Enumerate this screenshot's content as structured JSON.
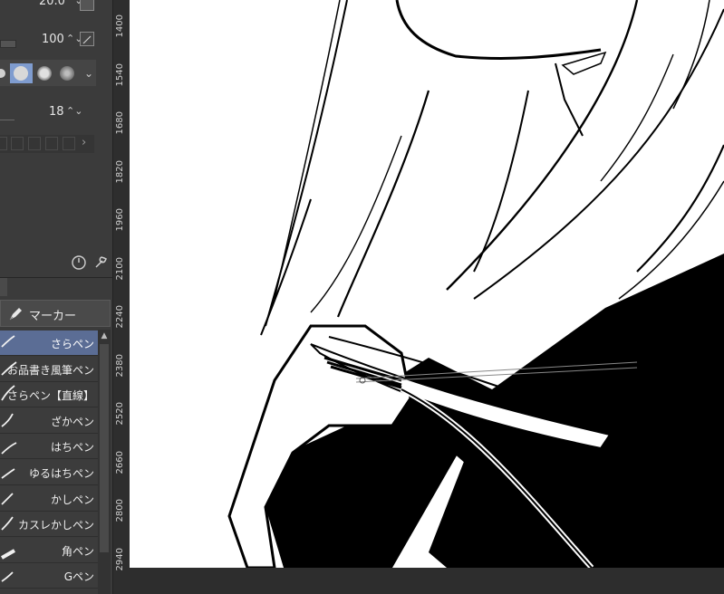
{
  "tool_properties": {
    "size_value": "20.0",
    "opacity_value": "100",
    "count_value": "18"
  },
  "tool_tab": {
    "label": "マーカー",
    "icon": "marker-pen-icon"
  },
  "brushes": [
    {
      "name": "さらペン",
      "selected": true
    },
    {
      "name": "お品書き風筆ペン",
      "selected": false
    },
    {
      "name": "さらペン【直線】",
      "selected": false
    },
    {
      "name": "ざかペン",
      "selected": false
    },
    {
      "name": "はちペン",
      "selected": false
    },
    {
      "name": "ゆるはちペン",
      "selected": false
    },
    {
      "name": "かしペン",
      "selected": false
    },
    {
      "name": "カスレかしペン",
      "selected": false
    },
    {
      "name": "角ペン",
      "selected": false
    },
    {
      "name": "Gペン",
      "selected": false
    }
  ],
  "ruler_labels": [
    "1400",
    "1540",
    "1680",
    "1820",
    "1960",
    "2100",
    "2240",
    "2380",
    "2520",
    "2660",
    "2800",
    "2940"
  ],
  "colors": {
    "panel_bg": "#3b3b3b",
    "selected_item": "#5b6d95",
    "accent_tip": "#7f9ccf"
  }
}
